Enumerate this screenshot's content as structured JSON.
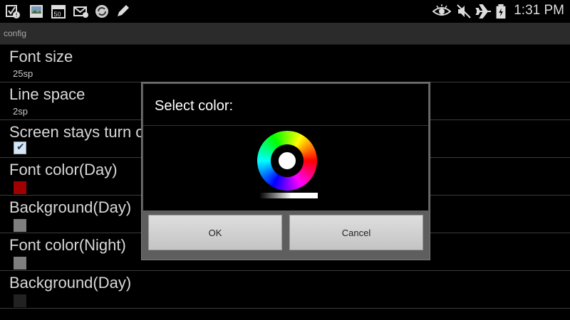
{
  "status_bar": {
    "time": "1:31 PM",
    "left_icons": [
      "notification-icon",
      "gallery-icon",
      "calendar-icon",
      "email-icon",
      "sync-icon",
      "pen-icon"
    ],
    "calendar_day": "50",
    "right_icons": [
      "eye-icon",
      "mute-icon",
      "airplane-icon",
      "battery-icon"
    ]
  },
  "app": {
    "title": "config"
  },
  "preferences": [
    {
      "title": "Font size",
      "summary": "25sp"
    },
    {
      "title": "Line space",
      "summary": "2sp"
    },
    {
      "title": "Screen stays turn on",
      "checked": true
    },
    {
      "title": "Font color(Day)",
      "swatch_color": "#a00000"
    },
    {
      "title": "Background(Day)",
      "swatch_color": "#7f7f7f"
    },
    {
      "title": "Font color(Night)",
      "swatch_color": "#7f7f7f"
    },
    {
      "title": "Background(Day)",
      "swatch_color": "#222222"
    }
  ],
  "dialog": {
    "title": "Select color:",
    "selected_color": "#ffffff",
    "ok_label": "OK",
    "cancel_label": "Cancel"
  }
}
